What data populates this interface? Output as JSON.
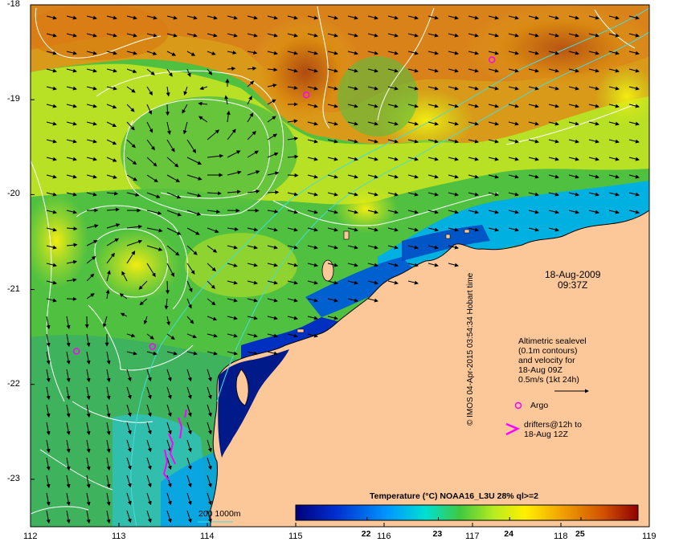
{
  "date_label": "18-Aug-2009",
  "time_label": "09:37Z",
  "annotations": {
    "sealevel": [
      "Altimetric sealevel",
      "(0.1m contours)",
      "and velocity for",
      "18-Aug 09Z",
      "0.5m/s (1kt 24h)"
    ],
    "argo": "Argo",
    "drifters": [
      "drifters@12h to",
      "18-Aug 12Z"
    ]
  },
  "depth_legend": "200  1000m",
  "colorbar": {
    "title": "Temperature (°C) NOAA16_L3U 28% ql>=2",
    "ticks": [
      "22",
      "23",
      "24",
      "25"
    ],
    "tick_values": [
      22,
      23,
      24,
      25
    ],
    "range": [
      21.0,
      25.8
    ]
  },
  "axes": {
    "x_ticks": [
      "112",
      "113",
      "114",
      "115",
      "116",
      "117",
      "118",
      "119"
    ],
    "y_ticks": [
      "-18",
      "-19",
      "-20",
      "-21",
      "-22",
      "-23"
    ],
    "x_range": [
      112,
      119
    ],
    "y_range": [
      -23.5,
      -18
    ]
  },
  "credit": "© IMOS 04-Apr-2015 03:54:34 Hobart time",
  "colors": {
    "land": "#fcc89a",
    "argo": "#ff00ff",
    "contour": "#ffffff",
    "isobath": "#44dddd"
  },
  "argo_floats": [
    {
      "lon": 112.52,
      "lat": -21.65
    },
    {
      "lon": 113.38,
      "lat": -21.6
    },
    {
      "lon": 115.12,
      "lat": -18.95
    },
    {
      "lon": 117.22,
      "lat": -18.58
    }
  ]
}
